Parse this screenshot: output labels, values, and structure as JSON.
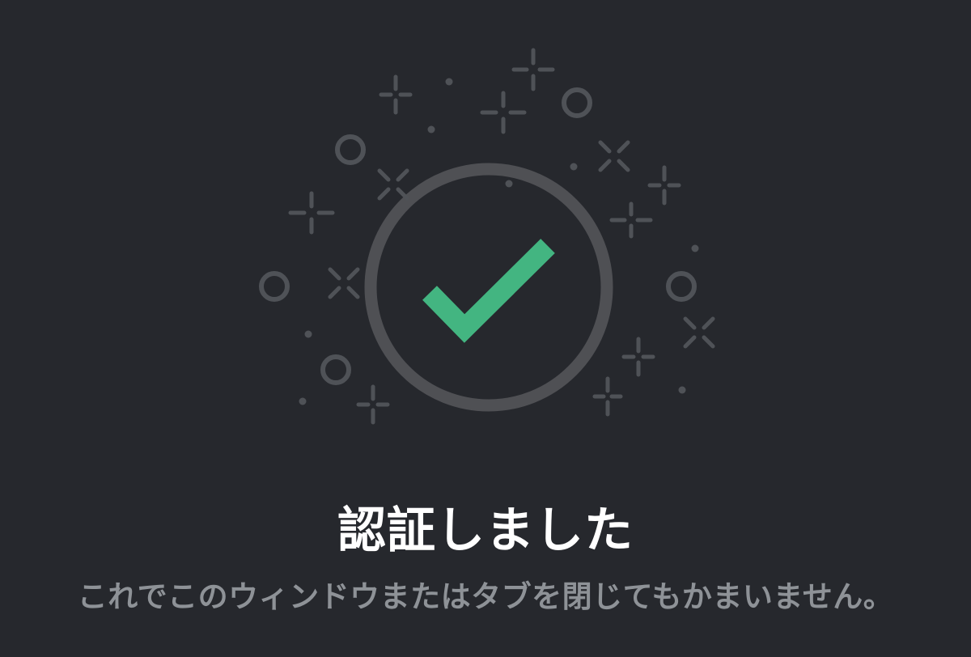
{
  "colors": {
    "background": "#26282d",
    "decoration": "#4f5257",
    "ring": "#4f5054",
    "check": "#43b581",
    "title": "#ffffff",
    "subtitle": "#8e9297"
  },
  "icons": {
    "status": "checkmark-icon",
    "decorations": [
      "sparkle-icon",
      "ring-icon",
      "dot-icon",
      "x-sparkle-icon"
    ]
  },
  "dialog": {
    "title": "認証しました",
    "message": "これでこのウィンドウまたはタブを閉じてもかまいません。"
  }
}
